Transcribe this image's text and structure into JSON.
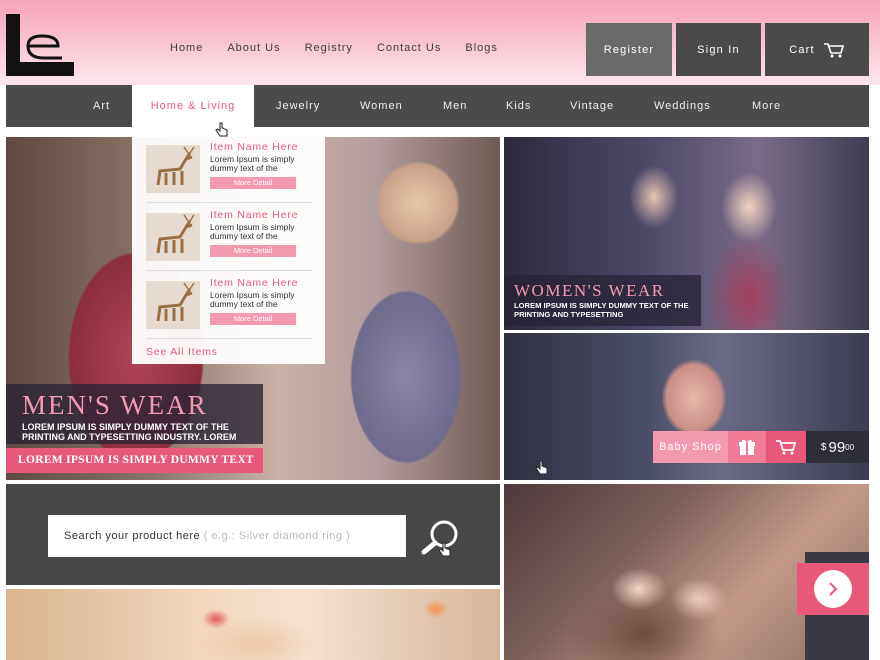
{
  "brand": {
    "logo_icon": "brand-logo-icon"
  },
  "topnav": [
    {
      "label": "Home"
    },
    {
      "label": "About Us"
    },
    {
      "label": "Registry"
    },
    {
      "label": "Contact Us"
    },
    {
      "label": "Blogs"
    }
  ],
  "auth": {
    "register": "Register",
    "signin": "Sign In",
    "cart": "Cart"
  },
  "categories": [
    {
      "label": "Art"
    },
    {
      "label": "Home & Living"
    },
    {
      "label": "Jewelry"
    },
    {
      "label": "Women"
    },
    {
      "label": "Men"
    },
    {
      "label": "Kids"
    },
    {
      "label": "Vintage"
    },
    {
      "label": "Weddings"
    },
    {
      "label": "More"
    }
  ],
  "dropdown": {
    "items": [
      {
        "name": "Item Name Here",
        "desc": "Lorem Ipsum is simply dummy text of the",
        "more": "More Detail"
      },
      {
        "name": "Item Name Here",
        "desc": "Lorem Ipsum is simply dummy text of the",
        "more": "More Detail"
      },
      {
        "name": "Item Name Here",
        "desc": "Lorem Ipsum is simply dummy text of the",
        "more": "More Detail"
      }
    ],
    "see_all": "See All Items"
  },
  "mens": {
    "title": "MEN'S WEAR",
    "subtitle": "LOREM IPSUM IS SIMPLY DUMMY TEXT OF THE PRINTING AND TYPESETTING INDUSTRY. LOREM",
    "strip": "LOREM IPSUM IS SIMPLY DUMMY TEXT"
  },
  "womens": {
    "title": "WOMEN'S WEAR",
    "subtitle": "LOREM IPSUM IS SIMPLY DUMMY TEXT OF THE PRINTING AND TYPESETTING"
  },
  "baby": {
    "label": "Baby Shop",
    "currency": "$",
    "price": "99",
    "cents": "00"
  },
  "search": {
    "placeholder": "Search your product here",
    "example": "( e.g.: Silver diamond ring )"
  },
  "colors": {
    "accent": "#e8587a",
    "accent_light": "#f49ab0",
    "dark": "#4b4b4b",
    "header_top": "#f5a3b8"
  }
}
